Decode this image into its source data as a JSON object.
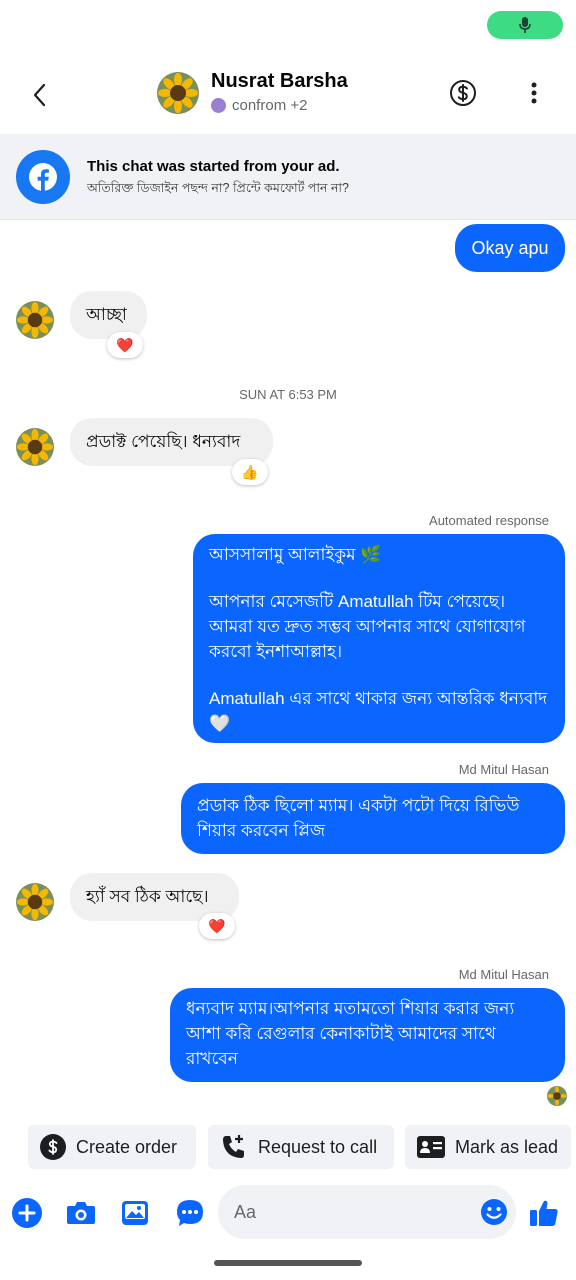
{
  "header": {
    "contact_name": "Nusrat Barsha",
    "contact_sub": "confrom +2"
  },
  "ad_banner": {
    "title": "This chat was started from your ad.",
    "subtitle": "অতিরিক্ত ডিজাইন পছন্দ না? প্রিন্টে কমফোর্ট পান না?"
  },
  "messages": {
    "m1": "Okay apu",
    "m2": "আচ্ছা",
    "time_sep": "SUN AT 6:53 PM",
    "m3": "প্রডাক্ট পেয়েছি। ধন্যবাদ",
    "auto_label": "Automated response",
    "m4_line1": "আসসালামু আলাইকুম 🌿",
    "m4_line2": "আপনার মেসেজটি Amatullah টিম পেয়েছে। আমরা যত দ্রুত সম্ভব আপনার সাথে যোগাযোগ করবো ইনশাআল্লাহ।",
    "m4_line3": "Amatullah এর সাথে থাকার জন্য আন্তরিক ধন্যবাদ 🤍",
    "sender1": "Md Mitul Hasan",
    "m5": "প্রডাক ঠিক ছিলো ম্যাম। একটা পটো দিয়ে রিভিউ শিয়ার করবেন প্লিজ",
    "m6": "হ্যাঁ সব ঠিক আছে।",
    "sender2": "Md Mitul Hasan",
    "m7": "ধন্যবাদ ম্যাম।আপনার মতামতো শিয়ার করার জন্য আশা করি রেগুলার কেনাকাটাই আমাদের সাথে রাখবেন"
  },
  "reactions": {
    "r1": "❤️",
    "r2": "👍",
    "r3": "❤️"
  },
  "quick_actions": {
    "create_order": "Create order",
    "request_call": "Request to call",
    "mark_lead": "Mark as lead"
  },
  "composer": {
    "placeholder": "Aa"
  },
  "colors": {
    "accent": "#0a66ff",
    "incoming_bubble": "#f0f0f0",
    "status_pill": "#3ddc84"
  },
  "icons": [
    "mic-icon",
    "back-arrow-icon",
    "dollar-circle-icon",
    "more-vertical-icon",
    "facebook-icon",
    "dollar-icon",
    "phone-plus-icon",
    "id-card-icon",
    "plus-circle-icon",
    "camera-icon",
    "image-icon",
    "chat-bubble-icon",
    "emoji-icon",
    "thumbs-up-icon"
  ]
}
